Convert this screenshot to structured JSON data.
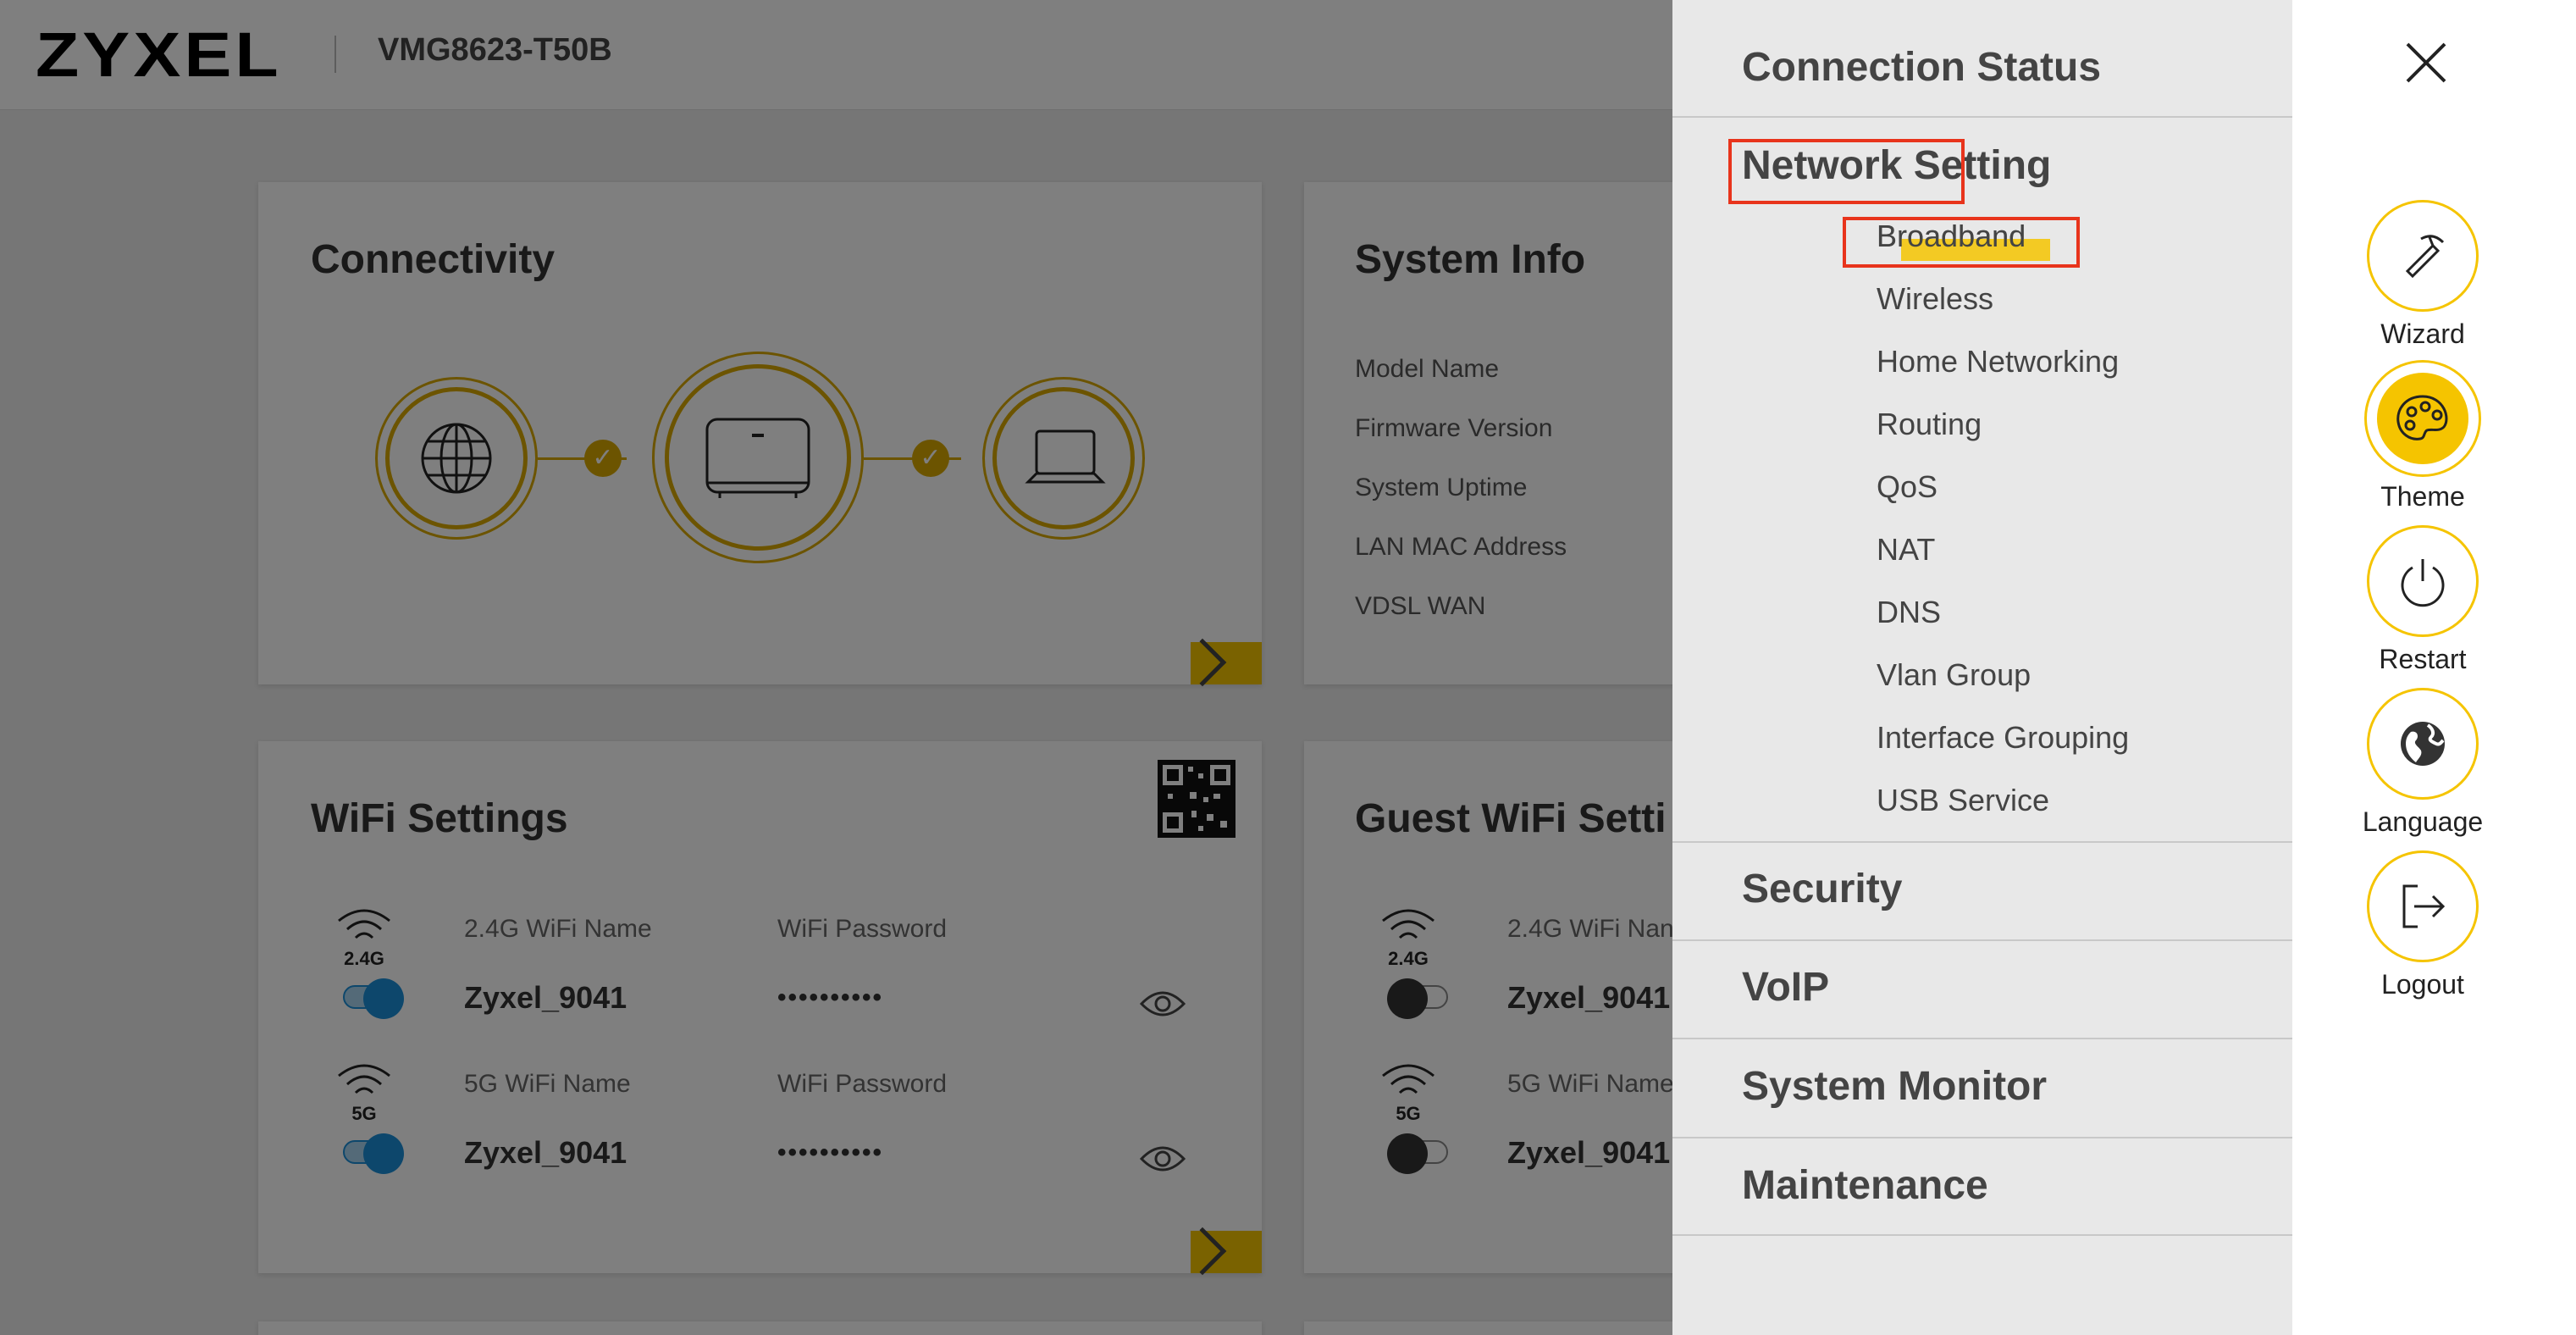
{
  "header": {
    "brand": "ZYXEL",
    "model": "VMG8623-T50B"
  },
  "connectivity": {
    "title": "Connectivity"
  },
  "system_info": {
    "title": "System Info",
    "labels": [
      "Model Name",
      "Firmware Version",
      "System Uptime",
      "LAN MAC Address",
      "VDSL WAN"
    ]
  },
  "wifi_settings": {
    "title": "WiFi Settings",
    "rows": [
      {
        "band": "2.4G",
        "name_label": "2.4G WiFi Name",
        "name": "Zyxel_9041",
        "pw_label": "WiFi Password",
        "password": "••••••••••",
        "enabled": true
      },
      {
        "band": "5G",
        "name_label": "5G WiFi Name",
        "name": "Zyxel_9041",
        "pw_label": "WiFi Password",
        "password": "••••••••••",
        "enabled": true
      }
    ]
  },
  "guest_wifi": {
    "title": "Guest WiFi Setti",
    "rows": [
      {
        "band": "2.4G",
        "name_label": "2.4G WiFi Nan",
        "name": "Zyxel_9041",
        "enabled": false
      },
      {
        "band": "5G",
        "name_label": "5G WiFi Name",
        "name": "Zyxel_9041",
        "enabled": false
      }
    ]
  },
  "menu": {
    "connection_status": "Connection Status",
    "network_setting": "Network Setting",
    "network_items": [
      "Broadband",
      "Wireless",
      "Home Networking",
      "Routing",
      "QoS",
      "NAT",
      "DNS",
      "Vlan Group",
      "Interface Grouping",
      "USB Service"
    ],
    "security": "Security",
    "voip": "VoIP",
    "system_monitor": "System Monitor",
    "maintenance": "Maintenance"
  },
  "side_actions": {
    "wizard": "Wizard",
    "theme": "Theme",
    "restart": "Restart",
    "language": "Language",
    "logout": "Logout"
  },
  "colors": {
    "accent": "#f5c400",
    "toggle_on": "#1a8fd8",
    "highlight_box": "#e8341c"
  }
}
